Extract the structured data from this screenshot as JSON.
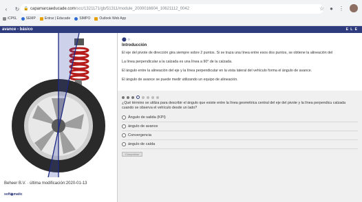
{
  "browser": {
    "url_host": "capamarcaeducade.com",
    "url_path": "/scc/1321171/gb/51311/module_2000016604_10621112_0042",
    "bookmarks": [
      "iCP6L",
      "SEMP",
      "Entrar | Educade",
      "SIMPO",
      "Outlook Web App"
    ]
  },
  "header": {
    "title": "avance - básico",
    "right": "E L E"
  },
  "left": {
    "footer": "Beheer B.V. · última modificación:2020-01-13",
    "logo": "soft◉matic"
  },
  "intro": {
    "title": "Introducción",
    "paragraphs": [
      "El eje del pivote de dirección gira siempre sobre 2 puntos. Si se traza una línea entre esos dos puntos, se obtiene la alineación del",
      "La línea perpendicular a la calzada es una línea a 90° de la calzada.",
      "El ángulo entre la alineación del eje y la línea perpendicular en la vista lateral del vehículo forma el ángulo de avance.",
      "El ángulo de avance se puede medir utilizando un equipo de alineación."
    ]
  },
  "quiz": {
    "question": "¿Qué término se utiliza para describir el ángulo que existe entre la línea geométrica central del eje del pivote y la línea perpendicu calzada cuando se observa el vehículo desde un lado?",
    "options": [
      "Ángulo de salida (KPI)",
      "ángulo de avance",
      "Convergencia",
      "ángulo de caída"
    ],
    "button": "Comprobar"
  },
  "colors": {
    "accent": "#2e3b7c"
  }
}
